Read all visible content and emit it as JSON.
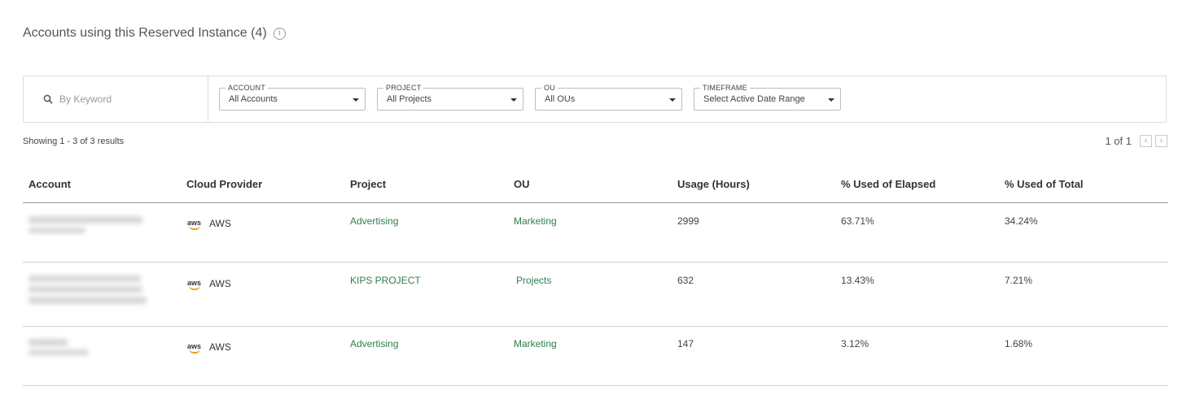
{
  "header": {
    "title": "Accounts using this Reserved Instance (4)",
    "info_icon": "info-icon"
  },
  "filters": {
    "search_placeholder": "By Keyword",
    "account": {
      "label": "ACCOUNT",
      "value": "All Accounts"
    },
    "project": {
      "label": "PROJECT",
      "value": "All Projects"
    },
    "ou": {
      "label": "OU",
      "value": "All OUs"
    },
    "timeframe": {
      "label": "TIMEFRAME",
      "value": "Select Active Date Range"
    }
  },
  "results": {
    "showing": "Showing 1 - 3 of 3 results",
    "pager": "1 of 1"
  },
  "colors": {
    "link": "#2e7d4f",
    "aws_orange": "#f29b1d"
  },
  "table": {
    "columns": [
      "Account",
      "Cloud Provider",
      "Project",
      "OU",
      "Usage (Hours)",
      "% Used of Elapsed",
      "% Used of Total"
    ],
    "rows": [
      {
        "provider": "AWS",
        "project": "Advertising",
        "ou": "Marketing",
        "usage": "2999",
        "elapsed": "63.71%",
        "total": "34.24%"
      },
      {
        "provider": "AWS",
        "project": "KIPS PROJECT",
        "ou": "Projects",
        "usage": "632",
        "elapsed": "13.43%",
        "total": "7.21%"
      },
      {
        "provider": "AWS",
        "project": "Advertising",
        "ou": "Marketing",
        "usage": "147",
        "elapsed": "3.12%",
        "total": "1.68%"
      }
    ]
  }
}
